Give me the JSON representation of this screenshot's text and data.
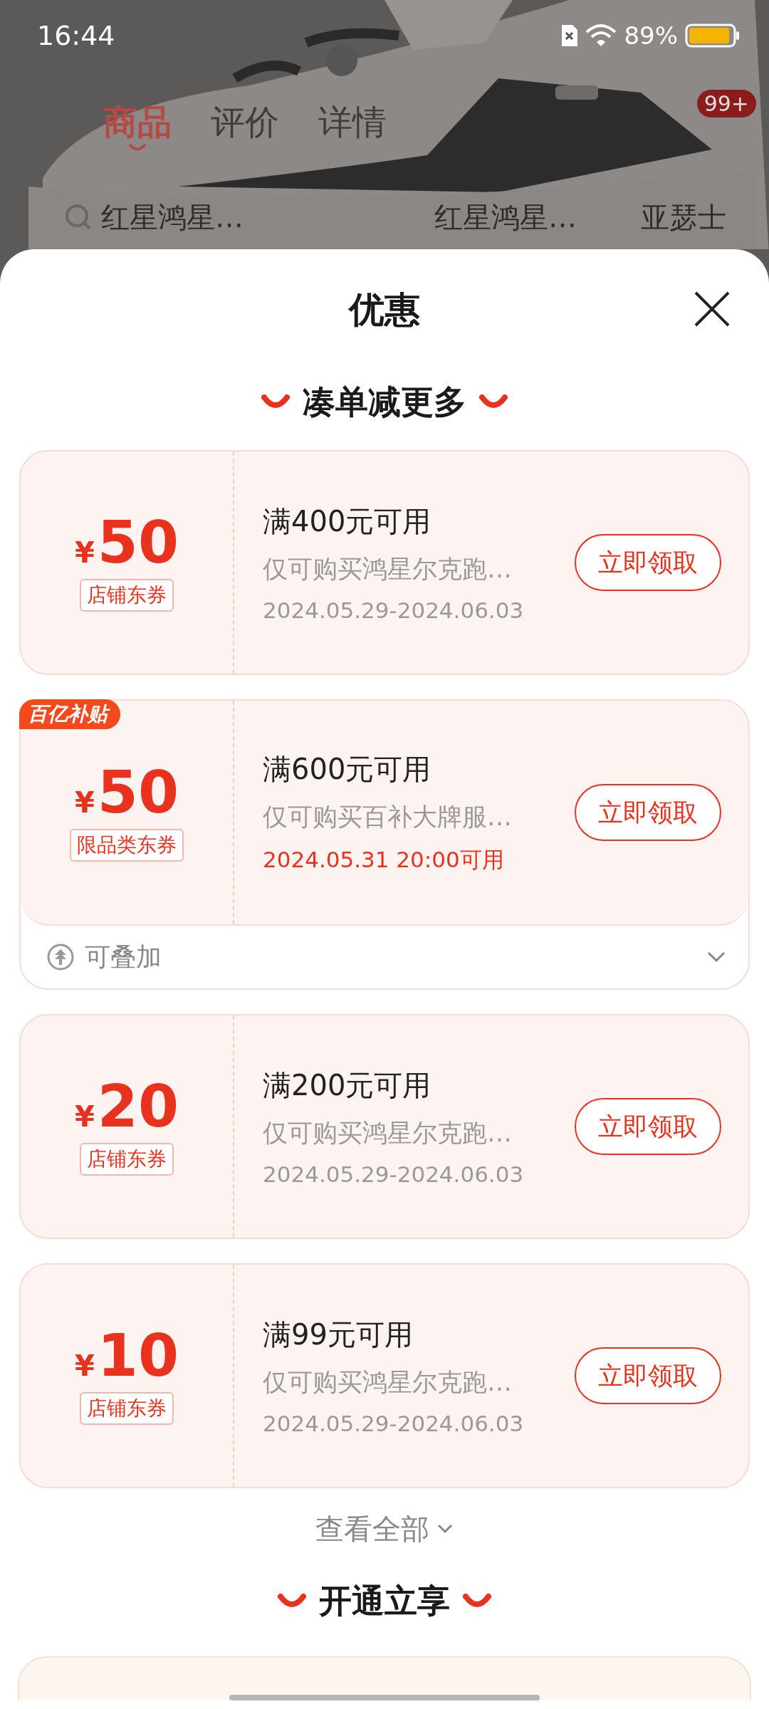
{
  "status_bar": {
    "time": "16:44",
    "battery": "89%"
  },
  "background_page": {
    "tabs": [
      {
        "label": "商品",
        "selected": true
      },
      {
        "label": "评价",
        "selected": false
      },
      {
        "label": "详情",
        "selected": false
      }
    ],
    "cart_badge": "99+",
    "search": {
      "placeholder": "红星鸿星…"
    },
    "suggestions": [
      "红星鸿星…",
      "亚瑟士"
    ]
  },
  "sheet": {
    "title": "优惠",
    "sections": [
      {
        "title": "凑单减更多",
        "coupons": [
          {
            "currency": "¥",
            "amount": "50",
            "tag": "店铺东券",
            "condition": "满400元可用",
            "scope": "仅可购买鸿星尔克跑…",
            "validity": "2024.05.29-2024.06.03",
            "validity_highlight": false,
            "button": "立即领取"
          },
          {
            "badge": "百亿补贴",
            "currency": "¥",
            "amount": "50",
            "tag": "限品类东券",
            "condition": "满600元可用",
            "scope": "仅可购买百补大牌服…",
            "validity": "2024.05.31 20:00可用",
            "validity_highlight": true,
            "button": "立即领取",
            "stack": {
              "label": "可叠加",
              "expanded": false
            }
          },
          {
            "currency": "¥",
            "amount": "20",
            "tag": "店铺东券",
            "condition": "满200元可用",
            "scope": "仅可购买鸿星尔克跑…",
            "validity": "2024.05.29-2024.06.03",
            "validity_highlight": false,
            "button": "立即领取"
          },
          {
            "currency": "¥",
            "amount": "10",
            "tag": "店铺东券",
            "condition": "满99元可用",
            "scope": "仅可购买鸿星尔克跑…",
            "validity": "2024.05.29-2024.06.03",
            "validity_highlight": false,
            "button": "立即领取"
          }
        ],
        "more": "查看全部"
      },
      {
        "title": "开通立享"
      }
    ]
  }
}
